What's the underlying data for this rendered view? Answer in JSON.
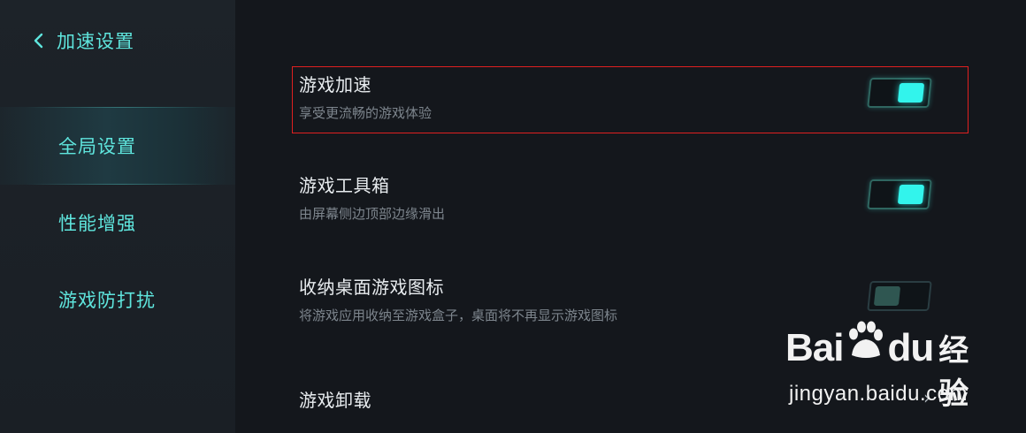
{
  "sidebar": {
    "back_label": "加速设置",
    "items": [
      {
        "label": "全局设置",
        "active": true
      },
      {
        "label": "性能增强",
        "active": false
      },
      {
        "label": "游戏防打扰",
        "active": false
      }
    ]
  },
  "settings": [
    {
      "title": "游戏加速",
      "subtitle": "享受更流畅的游戏体验",
      "toggle": "on"
    },
    {
      "title": "游戏工具箱",
      "subtitle": "由屏幕侧边顶部边缘滑出",
      "toggle": "on"
    },
    {
      "title": "收纳桌面游戏图标",
      "subtitle": "将游戏应用收纳至游戏盒子，桌面将不再显示游戏图标",
      "toggle": "off"
    },
    {
      "title": "游戏卸载",
      "chevron": "›"
    }
  ],
  "watermark": {
    "logo_text_1": "Bai",
    "logo_text_2": "du",
    "logo_cn": "经验",
    "url": "jingyan.baidu.com"
  },
  "colors": {
    "accent": "#5fe6de",
    "toggle_on": "#32f4ec",
    "highlight_border": "#e02020",
    "background": "#14171c"
  }
}
